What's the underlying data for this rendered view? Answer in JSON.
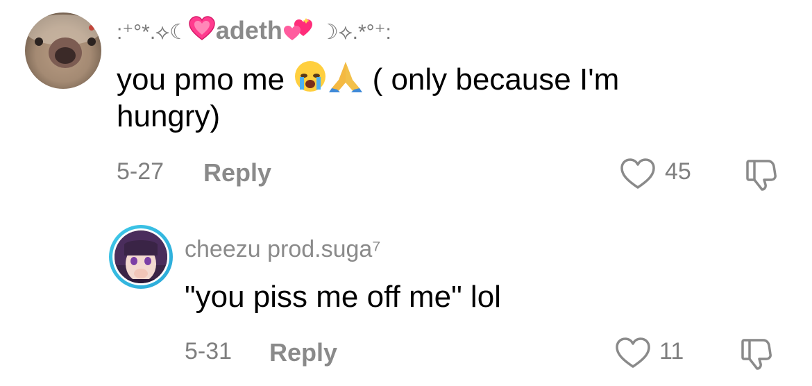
{
  "comments": [
    {
      "username_left": ":⁺°*.⟡☾",
      "username_name": "adeth",
      "username_right": "☽⟡.*°⁺:",
      "text_before": "you pmo me ",
      "text_after": " ( only because I'm hungry)",
      "date": "5-27",
      "reply_label": "Reply",
      "likes": "45",
      "emoji_icons": [
        "heart-pink-icon",
        "two-hearts-icon",
        "crying-face-icon",
        "folded-hands-icon"
      ]
    },
    {
      "username": "cheezu prod.suga⁷",
      "text": "\"you piss me off me\" lol",
      "date": "5-31",
      "reply_label": "Reply",
      "likes": "11"
    }
  ],
  "colors": {
    "meta_gray": "#7f7f7f",
    "username_gray": "#8a8a8a",
    "story_ring_start": "#3fc9e8",
    "story_ring_end": "#2aa8d8"
  }
}
